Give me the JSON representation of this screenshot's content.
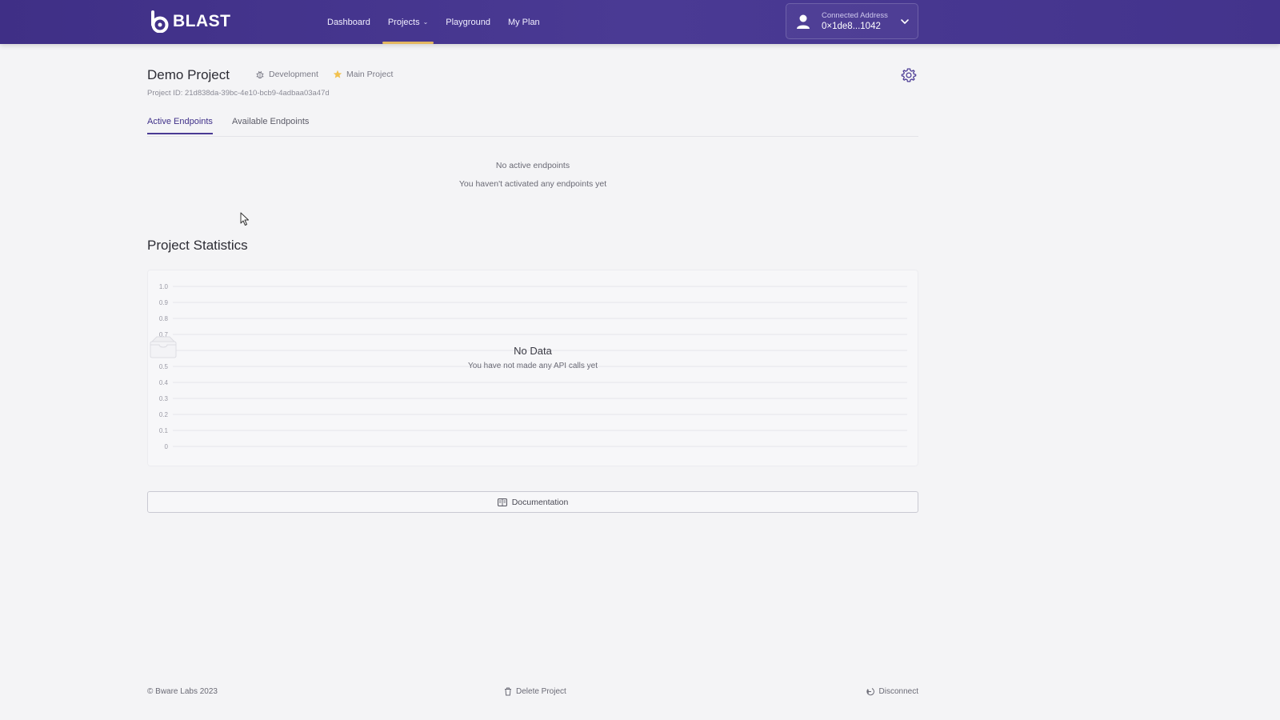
{
  "app": {
    "logo_text": "BLAST"
  },
  "nav": {
    "items": [
      {
        "label": "Dashboard"
      },
      {
        "label": "Projects",
        "has_dropdown": true,
        "active": true
      },
      {
        "label": "Playground"
      },
      {
        "label": "My Plan"
      }
    ]
  },
  "account": {
    "label": "Connected Address",
    "address": "0×1de8...1042",
    "icon": "user-icon"
  },
  "project": {
    "title": "Demo Project",
    "environment": "Development",
    "environment_icon": "bug-icon",
    "main_label": "Main Project",
    "main_icon": "star-icon",
    "id_text": "Project ID: 21d838da-39bc-4e10-bcb9-4adbaa03a47d"
  },
  "tabs": [
    {
      "label": "Active Endpoints",
      "active": true
    },
    {
      "label": "Available Endpoints"
    }
  ],
  "endpoints_empty": {
    "title": "No active endpoints",
    "subtitle": "You haven't activated any endpoints yet"
  },
  "statistics": {
    "title": "Project Statistics",
    "no_data_title": "No Data",
    "no_data_subtitle": "You have not made any API calls yet"
  },
  "chart_data": {
    "type": "line",
    "x": [],
    "series": [],
    "ylim": [
      0,
      1
    ],
    "yticks": [
      "1.0",
      "0.9",
      "0.8",
      "0.7",
      "0.6",
      "0.5",
      "0.4",
      "0.3",
      "0.2",
      "0.1",
      "0"
    ],
    "grid": true
  },
  "documentation": {
    "label": "Documentation",
    "icon": "book-icon"
  },
  "footer": {
    "copyright": "© Bware Labs 2023",
    "delete_label": "Delete Project",
    "delete_icon": "trash-icon",
    "disconnect_label": "Disconnect",
    "disconnect_icon": "logout-icon"
  },
  "colors": {
    "header_bg": "#43338c",
    "accent": "#e3b760",
    "star": "#f2c14e"
  }
}
